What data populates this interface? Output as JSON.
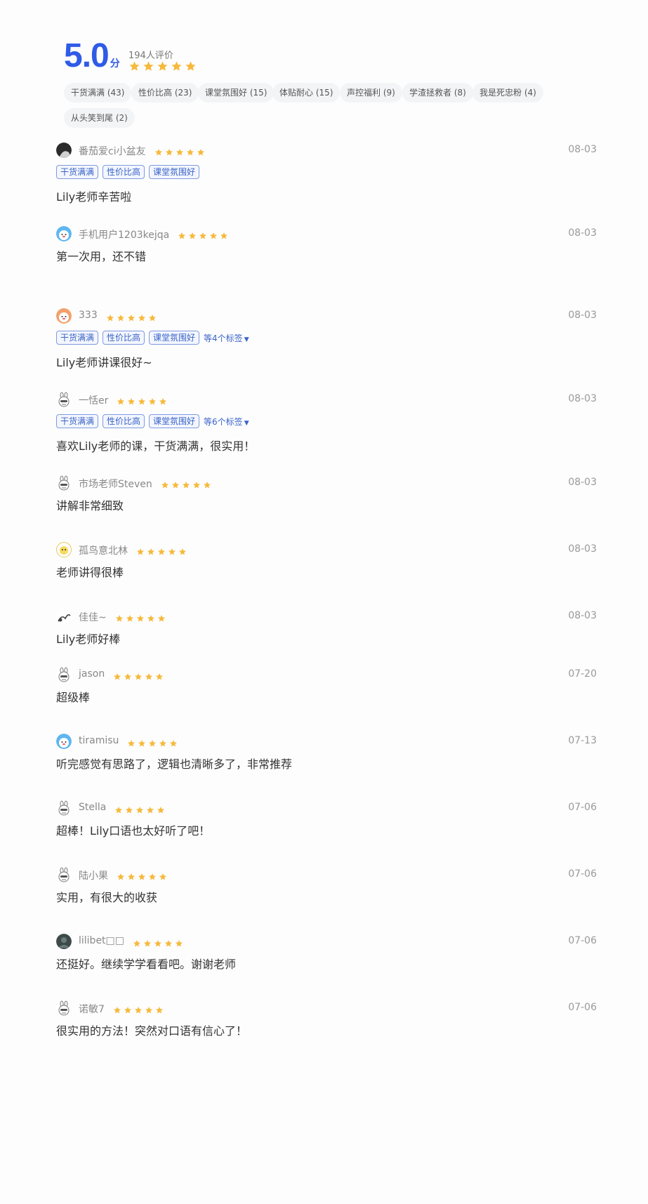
{
  "summary": {
    "score": "5.0",
    "unit": "分",
    "count": "194人评价",
    "stars": 5
  },
  "tags": [
    {
      "label": "干货满满 (43)"
    },
    {
      "label": "性价比高 (23)"
    },
    {
      "label": "课堂氛围好 (15)"
    },
    {
      "label": "体贴耐心 (15)"
    },
    {
      "label": "声控福利 (9)"
    },
    {
      "label": "学渣拯救者 (8)"
    },
    {
      "label": "我是死忠粉 (4)"
    },
    {
      "label": "从头笑到尾 (2)"
    }
  ],
  "colors": {
    "accent": "#2f5be6",
    "star": "#f6b93b",
    "tag_border": "#7f9ae0",
    "tag_text": "#3a63c8"
  },
  "reviews": [
    {
      "user": "番茄爱ci小盆友",
      "date": "08-03",
      "stars": 5,
      "avatar": "dark-portrait-avatar",
      "tags": [
        "干货满满",
        "性价比高",
        "课堂氛围好"
      ],
      "more": "",
      "content": "Lily老师辛苦啦"
    },
    {
      "user": "手机用户1203kejqa",
      "date": "08-03",
      "stars": 5,
      "avatar": "blue-bear-avatar",
      "tags": [],
      "more": "",
      "content": "第一次用，还不错"
    },
    {
      "user": "333",
      "date": "08-03",
      "stars": 5,
      "avatar": "orange-bear-avatar",
      "tags": [
        "干货满满",
        "性价比高",
        "课堂氛围好"
      ],
      "more": "等4个标签",
      "content": "Lily老师讲课很好~"
    },
    {
      "user": "一恬er",
      "date": "08-03",
      "stars": 5,
      "avatar": "rabbit-avatar",
      "tags": [
        "干货满满",
        "性价比高",
        "课堂氛围好"
      ],
      "more": "等6个标签",
      "content": "喜欢Lily老师的课，干货满满，很实用！"
    },
    {
      "user": "市场老师Steven",
      "date": "08-03",
      "stars": 5,
      "avatar": "rabbit-avatar",
      "tags": [],
      "more": "",
      "content": "讲解非常细致"
    },
    {
      "user": "孤鸟意北林",
      "date": "08-03",
      "stars": 5,
      "avatar": "yellow-cartoon-avatar",
      "tags": [],
      "more": "",
      "content": "老师讲得很棒"
    },
    {
      "user": "佳佳~",
      "date": "08-03",
      "stars": 5,
      "avatar": "sketch-avatar",
      "tags": [],
      "more": "",
      "content": "Lily老师好棒"
    },
    {
      "user": "jason",
      "date": "07-20",
      "stars": 5,
      "avatar": "rabbit-avatar",
      "tags": [],
      "more": "",
      "content": "超级棒"
    },
    {
      "user": "tiramisu",
      "date": "07-13",
      "stars": 5,
      "avatar": "blue-bear-avatar",
      "tags": [],
      "more": "",
      "content": "听完感觉有思路了，逻辑也清晰多了，非常推荐"
    },
    {
      "user": "Stella",
      "date": "07-06",
      "stars": 5,
      "avatar": "rabbit-avatar",
      "tags": [],
      "more": "",
      "content": "超棒！Lily口语也太好听了吧！"
    },
    {
      "user": "陆小果",
      "date": "07-06",
      "stars": 5,
      "avatar": "rabbit-avatar",
      "tags": [],
      "more": "",
      "content": "实用，有很大的收获"
    },
    {
      "user": "lilibet□□",
      "date": "07-06",
      "stars": 5,
      "avatar": "dark-photo-avatar",
      "tags": [],
      "more": "",
      "content": "还挺好。继续学学看看吧。谢谢老师"
    },
    {
      "user": "诺敏7",
      "date": "07-06",
      "stars": 5,
      "avatar": "rabbit-avatar",
      "tags": [],
      "more": "",
      "content": "很实用的方法！突然对口语有信心了！"
    }
  ]
}
